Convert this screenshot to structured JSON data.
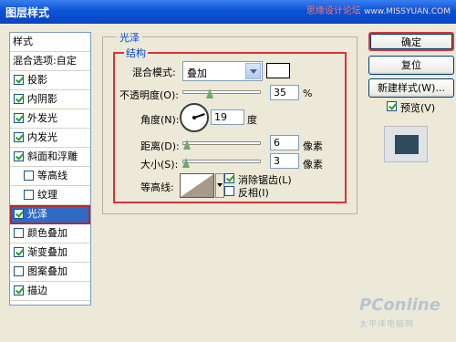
{
  "window": {
    "title": "图层样式",
    "watermark": "思缘设计论坛",
    "watermark_url": "www.MISSYUAN.COM"
  },
  "styles_panel": {
    "header": "样式",
    "blend_options": "混合选项:自定",
    "items": [
      {
        "label": "投影",
        "checked": true
      },
      {
        "label": "内阴影",
        "checked": true
      },
      {
        "label": "外发光",
        "checked": true
      },
      {
        "label": "内发光",
        "checked": true
      },
      {
        "label": "斜面和浮雕",
        "checked": true
      },
      {
        "label": "等高线",
        "checked": false,
        "indent": true
      },
      {
        "label": "纹理",
        "checked": false,
        "indent": true
      },
      {
        "label": "光泽",
        "checked": true,
        "selected": true
      },
      {
        "label": "颜色叠加",
        "checked": false
      },
      {
        "label": "渐变叠加",
        "checked": true
      },
      {
        "label": "图案叠加",
        "checked": false
      },
      {
        "label": "描边",
        "checked": true
      }
    ]
  },
  "satin": {
    "section_title": "光泽",
    "structure_title": "结构",
    "blend_mode_label": "混合模式:",
    "blend_mode_value": "叠加",
    "opacity_label": "不透明度(O):",
    "opacity_value": "35",
    "opacity_unit": "%",
    "opacity_level": 0.35,
    "angle_label": "角度(N):",
    "angle_value": "19",
    "angle_unit": "度",
    "distance_label": "距离(D):",
    "distance_value": "6",
    "distance_unit": "像素",
    "size_label": "大小(S):",
    "size_value": "3",
    "size_unit": "像素",
    "contour_label": "等高线:",
    "antialias_label": "消除锯齿(L)",
    "antialias_checked": true,
    "invert_label": "反相(I)",
    "invert_checked": false
  },
  "buttons": {
    "ok": "确定",
    "reset": "复位",
    "new_style": "新建样式(W)...",
    "preview_label": "预览(V)",
    "preview_checked": true
  },
  "footer_logo": {
    "brand": "PConline",
    "sub": "太平洋电脑网"
  },
  "colors": {
    "accent": "#316ac5",
    "highlight_box": "#dd3333",
    "preview": "#2f4a5a"
  }
}
